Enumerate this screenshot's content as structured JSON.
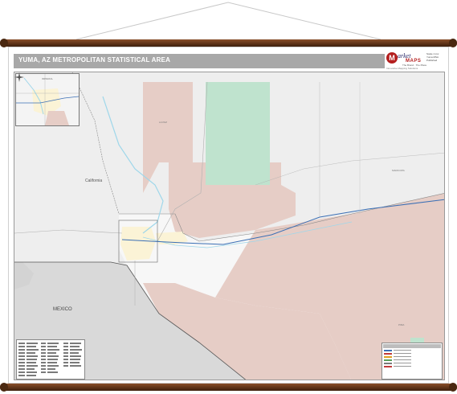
{
  "title": "YUMA, AZ METROPOLITAN STATISTICAL AREA",
  "brand": {
    "logo_letter": "M",
    "name": "arket",
    "maps": "MAPS",
    "tagline": "The Brand · The Place",
    "tagline2": "Innovative Mapping Solutions",
    "info_lines": [
      "Scale 1:xxx",
      "Yuma MSA",
      "Published"
    ]
  },
  "labels": {
    "mexico": "MEXICO",
    "california": "California",
    "inset_name": "IMPERIAL",
    "la_paz": "LA PAZ",
    "maricopa": "MARICOPA",
    "pima": "PIMA"
  },
  "colors": {
    "background": "#eeeeee",
    "military_land": "#e6cdc6",
    "national_park": "#bfe3ce",
    "urban": "#fbf3d6",
    "water": "#9fd7ea",
    "highway": "#3b6fb5",
    "road": "#b0b0b0",
    "mexico": "#d9d9d9",
    "rod": "#5c3217"
  },
  "legend": {
    "swatches": [
      "#3b6fb5",
      "#c23a3a",
      "#e0a020",
      "#5b9e5b",
      "#7a7a7a",
      "#c23a3a"
    ]
  }
}
